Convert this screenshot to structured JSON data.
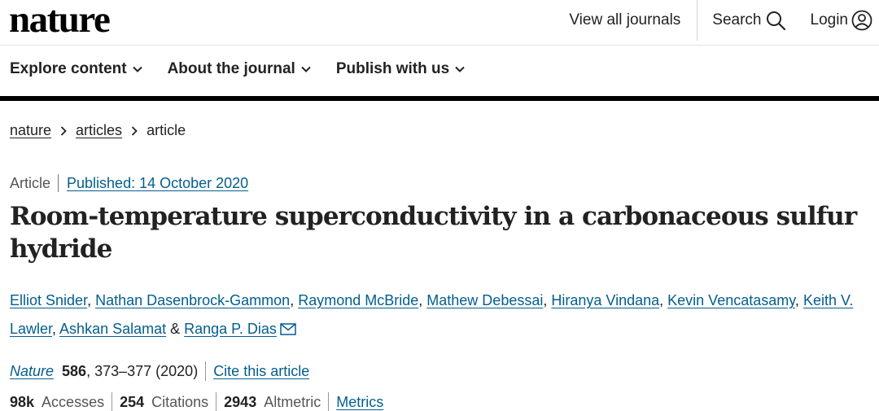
{
  "header": {
    "logo": "nature",
    "view_all_journals": "View all journals",
    "search": "Search",
    "login": "Login"
  },
  "nav": {
    "items": [
      {
        "label": "Explore content"
      },
      {
        "label": "About the journal"
      },
      {
        "label": "Publish with us"
      }
    ]
  },
  "breadcrumb": {
    "items": [
      "nature",
      "articles",
      "article"
    ]
  },
  "article": {
    "type": "Article",
    "published": "Published: 14 October 2020",
    "title": "Room-temperature superconductivity in a carbonaceous sulfur hydride",
    "authors": [
      "Elliot Snider",
      "Nathan Dasenbrock-Gammon",
      "Raymond McBride",
      "Mathew Debessai",
      "Hiranya Vindana",
      "Kevin Vencatasamy",
      "Keith V. Lawler",
      "Ashkan Salamat",
      "Ranga P. Dias"
    ],
    "author_sep": ", ",
    "author_and": " & ",
    "journal": "Nature",
    "volume": "586",
    "pages_year": ", 373–377 (2020)",
    "cite": "Cite this article",
    "accesses_value": "98k",
    "accesses_label": "Accesses",
    "citations_value": "254",
    "citations_label": "Citations",
    "altmetric_value": "2943",
    "altmetric_label": "Altmetric",
    "metrics": "Metrics"
  },
  "colors": {
    "link": "#025e8d",
    "text": "#222222"
  }
}
